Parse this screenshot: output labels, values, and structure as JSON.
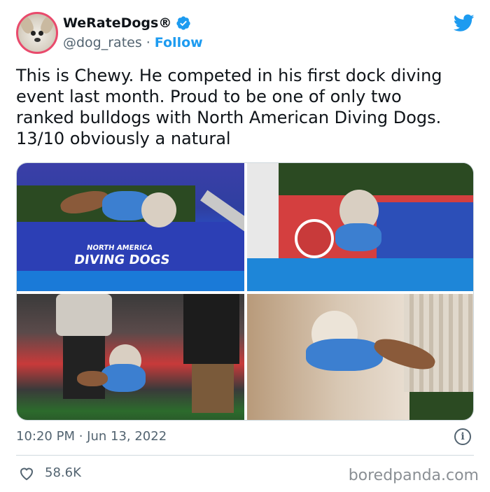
{
  "header": {
    "display_name": "WeRateDogs®",
    "handle": "@dog_rates",
    "separator": "·",
    "follow_label": "Follow"
  },
  "tweet": {
    "text": "This is Chewy. He competed in his first dock diving\nevent last month. Proud to be one of only two\nranked bulldogs with North American Diving Dogs.\n13/10 obviously a natural"
  },
  "photos": {
    "photo1_banner_line1": "NORTH AMERICA",
    "photo1_banner_line2": "DIVING DOGS"
  },
  "footer": {
    "timestamp": "10:20 PM · Jun 13, 2022",
    "info_glyph": "i",
    "likes": "58.6K"
  },
  "watermark": "boredpanda.com",
  "colors": {
    "accent": "#1d9bf0",
    "text": "#0f1419",
    "muted": "#536471"
  },
  "icons": [
    "verified-badge-icon",
    "twitter-bird-icon",
    "info-icon",
    "heart-icon"
  ]
}
